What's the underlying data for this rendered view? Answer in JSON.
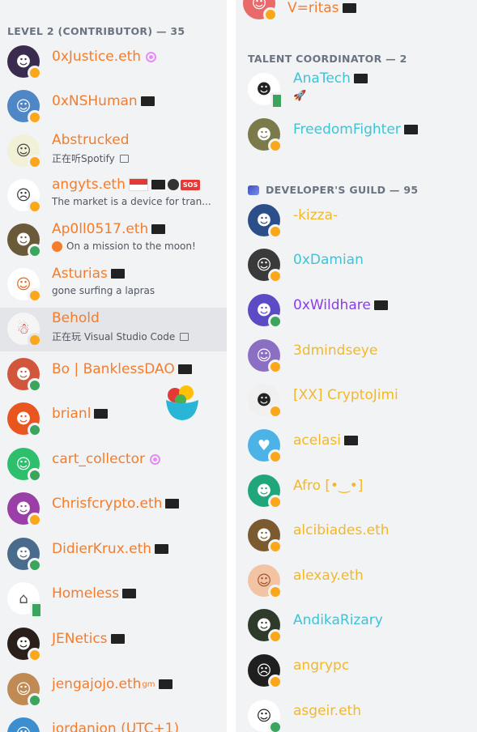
{
  "left_section": {
    "header": "LEVEL 2 (CONTRIBUTOR) — 35",
    "members": [
      {
        "name": "0xJustice.eth",
        "badge": "nitro",
        "status": "idle"
      },
      {
        "name": "0xNSHuman",
        "badge": "flag",
        "status": "idle"
      },
      {
        "name": "Abstrucked",
        "sub": "正在听Spotify",
        "status": "idle"
      },
      {
        "name": "angyts.eth",
        "badge": "sg-flags",
        "sub": "The market is a device for tran...",
        "status": "idle"
      },
      {
        "name": "Ap0ll0517.eth",
        "badge": "flag",
        "sub": "On a mission to the moon!",
        "status": "online"
      },
      {
        "name": "Asturias",
        "badge": "flag",
        "sub": "gone surfing a lapras",
        "status": "idle"
      },
      {
        "name": "Behold",
        "sub": "正在玩 Visual Studio Code",
        "status": "idle"
      },
      {
        "name": "Bo | BanklessDAO",
        "badge": "flag",
        "status": "online"
      },
      {
        "name": "brianl",
        "badge": "flag",
        "status": "online"
      },
      {
        "name": "cart_collector",
        "badge": "nitro",
        "status": "online"
      },
      {
        "name": "Chrisfcrypto.eth",
        "badge": "flag",
        "status": "idle"
      },
      {
        "name": "DidierKrux.eth",
        "badge": "flag",
        "status": "online"
      },
      {
        "name": "Homeless",
        "badge": "flag",
        "status": "phone"
      },
      {
        "name": "JENetics",
        "badge": "flag",
        "status": "idle"
      },
      {
        "name": "jengajojo.eth",
        "name_sup": "gm",
        "badge": "flag",
        "status": "online"
      },
      {
        "name": "jordanion (UTC+1)",
        "status": "online"
      }
    ]
  },
  "right_top_member": {
    "name": "V=ritas",
    "badge": "flag",
    "status": "idle"
  },
  "talent_section": {
    "header": "TALENT COORDINATOR — 2",
    "members": [
      {
        "name": "AnaTech",
        "badge": "flag",
        "sub": "🚀",
        "status": "phone"
      },
      {
        "name": "FreedomFighter",
        "badge": "flag",
        "status": "idle"
      }
    ]
  },
  "dev_section": {
    "header": "DEVELOPER'S GUILD — 95",
    "members": [
      {
        "name": "-kizza-",
        "status": "idle"
      },
      {
        "name": "0xDamian",
        "status": "idle"
      },
      {
        "name": "0xWildhare",
        "badge": "flag",
        "status": "online"
      },
      {
        "name": "3dmindseye",
        "status": "idle"
      },
      {
        "name": "[XX] CryptoJimi",
        "status": "idle"
      },
      {
        "name": "acelasi",
        "badge": "flag",
        "status": "idle"
      },
      {
        "name": "Afro [•‿•]",
        "status": "idle"
      },
      {
        "name": "alcibiades.eth",
        "status": "idle"
      },
      {
        "name": "alexay.eth",
        "status": "idle"
      },
      {
        "name": "AndikaRizary",
        "status": "idle"
      },
      {
        "name": "angrypc",
        "status": "idle"
      },
      {
        "name": "asgeir.eth",
        "status": "online"
      }
    ]
  },
  "colors": {
    "contributor": "#f57c2a",
    "talent": "#3fc3d6",
    "developer": "#f2b829",
    "wildhare": "#8c3cf0",
    "online": "#3ba55d",
    "idle": "#faa81a"
  }
}
